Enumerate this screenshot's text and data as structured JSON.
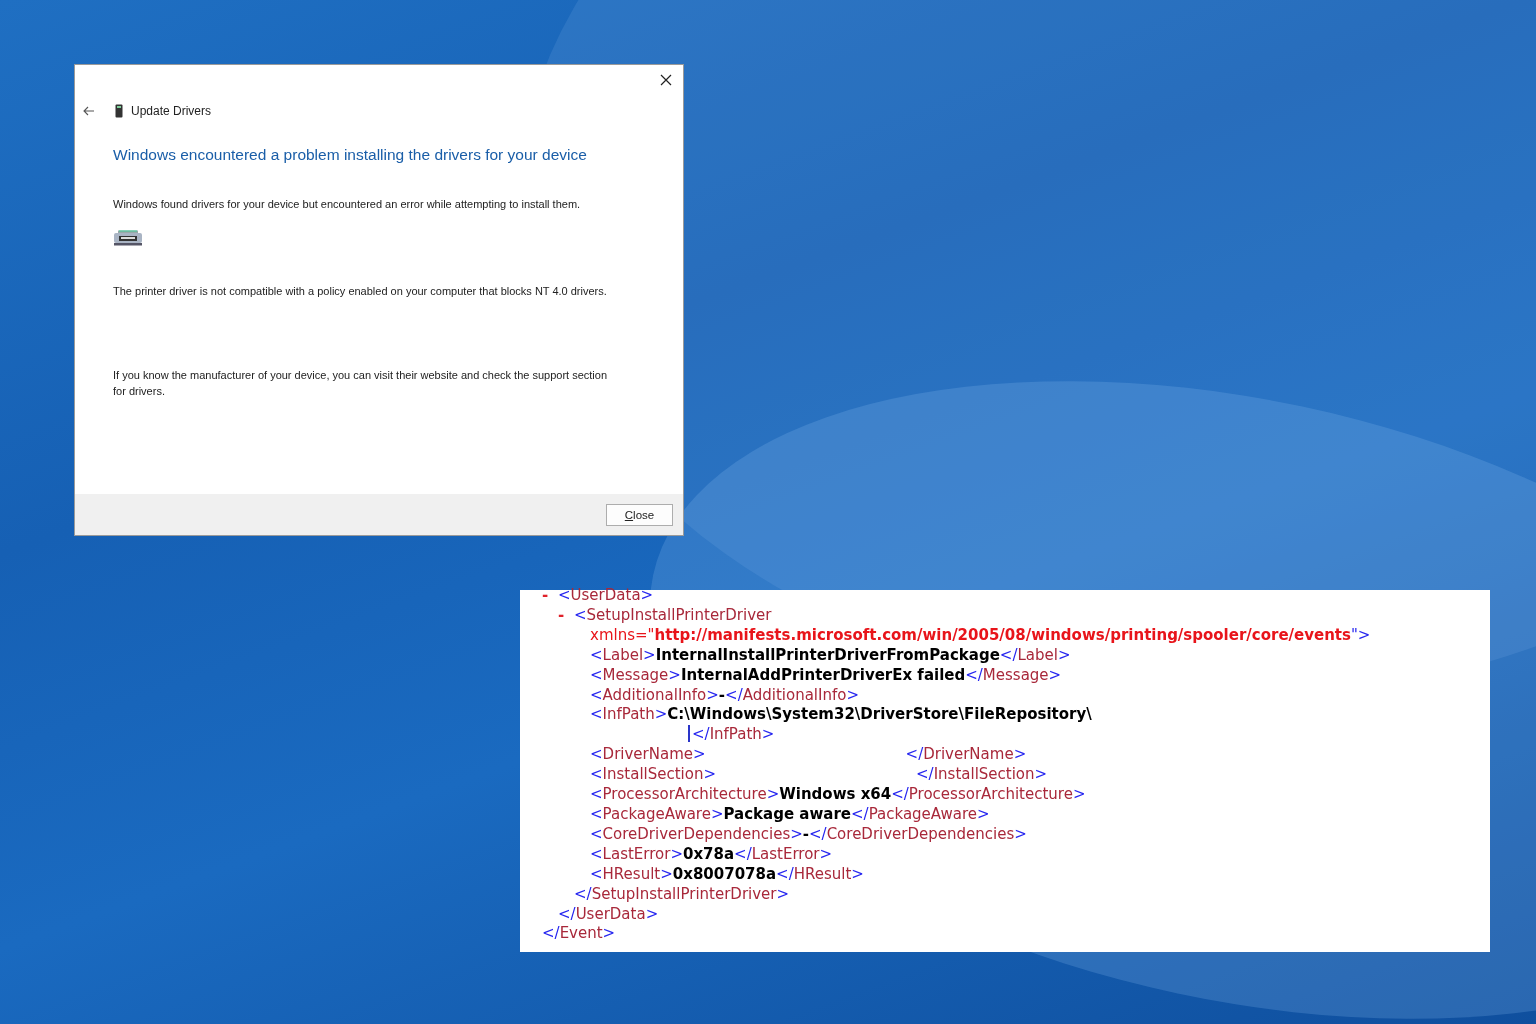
{
  "dialog": {
    "title": "Update Drivers",
    "heading": "Windows encountered a problem installing the drivers for your device",
    "paragraphs": [
      "Windows found drivers for your device but encountered an error while attempting to install them.",
      "The printer driver is not compatible with a policy enabled on your computer that blocks NT 4.0 drivers.",
      "If you know the manufacturer of your device, you can visit their website and check the support section for drivers."
    ],
    "buttons": [
      "Close"
    ]
  },
  "xml_view": {
    "children": [
      {
        "toggle": "-",
        "open": [
          {
            "kind": "punct",
            "text": "<"
          },
          {
            "kind": "tag",
            "text": "UserData"
          },
          {
            "kind": "punct",
            "text": ">"
          }
        ],
        "children": [
          {
            "toggle": "-",
            "open": [
              {
                "kind": "punct",
                "text": "<"
              },
              {
                "kind": "tag",
                "text": "SetupInstallPrinterDriver"
              }
            ],
            "children": [
              {
                "tokens": [
                  {
                    "kind": "attr",
                    "text": "xmlns=\""
                  },
                  {
                    "kind": "attrval",
                    "text": "http://manifests.microsoft.com/win/2005/08/windows/printing/spooler/core/events"
                  },
                  {
                    "kind": "punct",
                    "text": "\">"
                  }
                ]
              },
              {
                "tokens": [
                  {
                    "kind": "punct",
                    "text": "<"
                  },
                  {
                    "kind": "tag",
                    "text": "Label"
                  },
                  {
                    "kind": "punct",
                    "text": ">"
                  },
                  {
                    "kind": "value",
                    "text": "InternalInstallPrinterDriverFromPackage"
                  },
                  {
                    "kind": "punct",
                    "text": "</"
                  },
                  {
                    "kind": "tag",
                    "text": "Label"
                  },
                  {
                    "kind": "punct",
                    "text": ">"
                  }
                ]
              },
              {
                "tokens": [
                  {
                    "kind": "punct",
                    "text": "<"
                  },
                  {
                    "kind": "tag",
                    "text": "Message"
                  },
                  {
                    "kind": "punct",
                    "text": ">"
                  },
                  {
                    "kind": "value",
                    "text": "InternalAddPrinterDriverEx failed"
                  },
                  {
                    "kind": "punct",
                    "text": "</"
                  },
                  {
                    "kind": "tag",
                    "text": "Message"
                  },
                  {
                    "kind": "punct",
                    "text": ">"
                  }
                ]
              },
              {
                "tokens": [
                  {
                    "kind": "punct",
                    "text": "<"
                  },
                  {
                    "kind": "tag",
                    "text": "AdditionalInfo"
                  },
                  {
                    "kind": "punct",
                    "text": ">"
                  },
                  {
                    "kind": "value",
                    "text": "-"
                  },
                  {
                    "kind": "punct",
                    "text": "</"
                  },
                  {
                    "kind": "tag",
                    "text": "AdditionalInfo"
                  },
                  {
                    "kind": "punct",
                    "text": ">"
                  }
                ]
              },
              {
                "tokens": [
                  {
                    "kind": "punct",
                    "text": "<"
                  },
                  {
                    "kind": "tag",
                    "text": "InfPath"
                  },
                  {
                    "kind": "punct",
                    "text": ">"
                  },
                  {
                    "kind": "value",
                    "text": "C:\\Windows\\System32\\DriverStore\\FileRepository\\"
                  },
                  {
                    "kind": "wrap"
                  },
                  {
                    "kind": "caret"
                  },
                  {
                    "kind": "punct",
                    "text": "</"
                  },
                  {
                    "kind": "tag",
                    "text": "InfPath"
                  },
                  {
                    "kind": "punct",
                    "text": ">"
                  }
                ]
              },
              {
                "tokens": [
                  {
                    "kind": "punct",
                    "text": "<"
                  },
                  {
                    "kind": "tag",
                    "text": "DriverName"
                  },
                  {
                    "kind": "punct",
                    "text": ">"
                  },
                  {
                    "kind": "blank"
                  },
                  {
                    "kind": "punct",
                    "text": "</"
                  },
                  {
                    "kind": "tag",
                    "text": "DriverName"
                  },
                  {
                    "kind": "punct",
                    "text": ">"
                  }
                ]
              },
              {
                "tokens": [
                  {
                    "kind": "punct",
                    "text": "<"
                  },
                  {
                    "kind": "tag",
                    "text": "InstallSection"
                  },
                  {
                    "kind": "punct",
                    "text": ">"
                  },
                  {
                    "kind": "blank"
                  },
                  {
                    "kind": "punct",
                    "text": "</"
                  },
                  {
                    "kind": "tag",
                    "text": "InstallSection"
                  },
                  {
                    "kind": "punct",
                    "text": ">"
                  }
                ]
              },
              {
                "tokens": [
                  {
                    "kind": "punct",
                    "text": "<"
                  },
                  {
                    "kind": "tag",
                    "text": "ProcessorArchitecture"
                  },
                  {
                    "kind": "punct",
                    "text": ">"
                  },
                  {
                    "kind": "value",
                    "text": "Windows x64"
                  },
                  {
                    "kind": "punct",
                    "text": "</"
                  },
                  {
                    "kind": "tag",
                    "text": "ProcessorArchitecture"
                  },
                  {
                    "kind": "punct",
                    "text": ">"
                  }
                ]
              },
              {
                "tokens": [
                  {
                    "kind": "punct",
                    "text": "<"
                  },
                  {
                    "kind": "tag",
                    "text": "PackageAware"
                  },
                  {
                    "kind": "punct",
                    "text": ">"
                  },
                  {
                    "kind": "value",
                    "text": "Package aware"
                  },
                  {
                    "kind": "punct",
                    "text": "</"
                  },
                  {
                    "kind": "tag",
                    "text": "PackageAware"
                  },
                  {
                    "kind": "punct",
                    "text": ">"
                  }
                ]
              },
              {
                "tokens": [
                  {
                    "kind": "punct",
                    "text": "<"
                  },
                  {
                    "kind": "tag",
                    "text": "CoreDriverDependencies"
                  },
                  {
                    "kind": "punct",
                    "text": ">"
                  },
                  {
                    "kind": "value",
                    "text": "-"
                  },
                  {
                    "kind": "punct",
                    "text": "</"
                  },
                  {
                    "kind": "tag",
                    "text": "CoreDriverDependencies"
                  },
                  {
                    "kind": "punct",
                    "text": ">"
                  }
                ]
              },
              {
                "tokens": [
                  {
                    "kind": "punct",
                    "text": "<"
                  },
                  {
                    "kind": "tag",
                    "text": "LastError"
                  },
                  {
                    "kind": "punct",
                    "text": ">"
                  },
                  {
                    "kind": "value",
                    "text": "0x78a"
                  },
                  {
                    "kind": "punct",
                    "text": "</"
                  },
                  {
                    "kind": "tag",
                    "text": "LastError"
                  },
                  {
                    "kind": "punct",
                    "text": ">"
                  }
                ]
              },
              {
                "tokens": [
                  {
                    "kind": "punct",
                    "text": "<"
                  },
                  {
                    "kind": "tag",
                    "text": "HResult"
                  },
                  {
                    "kind": "punct",
                    "text": ">"
                  },
                  {
                    "kind": "value",
                    "text": "0x8007078a"
                  },
                  {
                    "kind": "punct",
                    "text": "</"
                  },
                  {
                    "kind": "tag",
                    "text": "HResult"
                  },
                  {
                    "kind": "punct",
                    "text": ">"
                  }
                ]
              }
            ],
            "close": [
              {
                "kind": "punct",
                "text": "</"
              },
              {
                "kind": "tag",
                "text": "SetupInstallPrinterDriver"
              },
              {
                "kind": "punct",
                "text": ">"
              }
            ]
          }
        ],
        "close": [
          {
            "kind": "punct",
            "text": "</"
          },
          {
            "kind": "tag",
            "text": "UserData"
          },
          {
            "kind": "punct",
            "text": ">"
          }
        ]
      }
    ],
    "close": [
      {
        "kind": "punct",
        "text": "</"
      },
      {
        "kind": "tag",
        "text": "Event"
      },
      {
        "kind": "punct",
        "text": ">"
      }
    ]
  }
}
